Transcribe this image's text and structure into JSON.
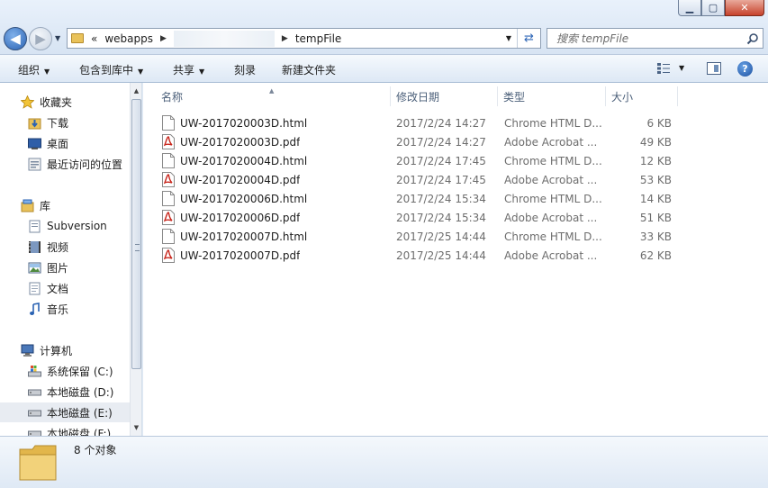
{
  "window": {
    "minimize_glyph": "▁",
    "maximize_glyph": "▢",
    "close_glyph": "✕"
  },
  "address": {
    "overflow_glyph": "«",
    "segments": [
      "webapps",
      "tempFile"
    ],
    "separator": "▶"
  },
  "search": {
    "placeholder": "搜索 tempFile"
  },
  "commands": {
    "organize": "组织",
    "include_in_library": "包含到库中",
    "share": "共享",
    "burn": "刻录",
    "new_folder": "新建文件夹",
    "help_glyph": "?"
  },
  "nav": {
    "favorites": {
      "label": "收藏夹",
      "items": [
        "下载",
        "桌面",
        "最近访问的位置"
      ]
    },
    "libraries": {
      "label": "库",
      "items": [
        "Subversion",
        "视频",
        "图片",
        "文档",
        "音乐"
      ]
    },
    "computer": {
      "label": "计算机",
      "items": [
        "系统保留 (C:)",
        "本地磁盘 (D:)",
        "本地磁盘 (E:)",
        "本地磁盘 (F:)"
      ],
      "selected_index": 2
    }
  },
  "columns": {
    "name": "名称",
    "date": "修改日期",
    "type": "类型",
    "size": "大小"
  },
  "files": [
    {
      "name": "UW-2017020003D.html",
      "date": "2017/2/24 14:27",
      "type": "Chrome HTML D...",
      "size": "6 KB",
      "icon": "html-file-icon"
    },
    {
      "name": "UW-2017020003D.pdf",
      "date": "2017/2/24 14:27",
      "type": "Adobe Acrobat ...",
      "size": "49 KB",
      "icon": "pdf-file-icon"
    },
    {
      "name": "UW-2017020004D.html",
      "date": "2017/2/24 17:45",
      "type": "Chrome HTML D...",
      "size": "12 KB",
      "icon": "html-file-icon"
    },
    {
      "name": "UW-2017020004D.pdf",
      "date": "2017/2/24 17:45",
      "type": "Adobe Acrobat ...",
      "size": "53 KB",
      "icon": "pdf-file-icon"
    },
    {
      "name": "UW-2017020006D.html",
      "date": "2017/2/24 15:34",
      "type": "Chrome HTML D...",
      "size": "14 KB",
      "icon": "html-file-icon"
    },
    {
      "name": "UW-2017020006D.pdf",
      "date": "2017/2/24 15:34",
      "type": "Adobe Acrobat ...",
      "size": "51 KB",
      "icon": "pdf-file-icon"
    },
    {
      "name": "UW-2017020007D.html",
      "date": "2017/2/25 14:44",
      "type": "Chrome HTML D...",
      "size": "33 KB",
      "icon": "html-file-icon"
    },
    {
      "name": "UW-2017020007D.pdf",
      "date": "2017/2/25 14:44",
      "type": "Adobe Acrobat ...",
      "size": "62 KB",
      "icon": "pdf-file-icon"
    }
  ],
  "details": {
    "count_text": "8 个对象"
  },
  "colors": {
    "accent": "#2b63b3",
    "pdf_red": "#c8261c",
    "selection": "#e8ecf2"
  }
}
